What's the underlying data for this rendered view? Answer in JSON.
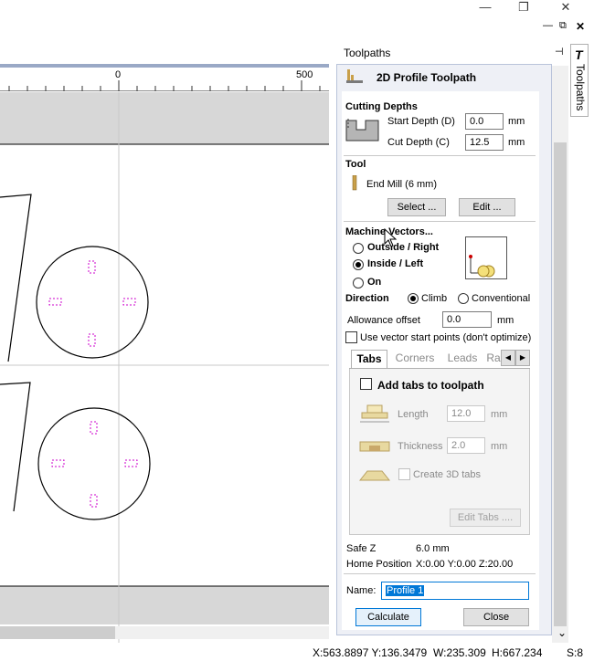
{
  "window": {
    "minimize_glyph": "—",
    "restore_glyph": "❐",
    "close_glyph": "✕",
    "inner_minimize_glyph": "—",
    "inner_restore_glyph": "⧉",
    "inner_close_glyph": "✕"
  },
  "ruler": {
    "labels": [
      "0",
      "500"
    ]
  },
  "panel": {
    "header": "Toolpaths",
    "title": "2D Profile Toolpath",
    "pin_glyph": "⊣",
    "close_glyph": "✕",
    "side_tab_label": "Toolpaths",
    "side_tab_icon": "T"
  },
  "cutting_depths": {
    "heading": "Cutting Depths",
    "start_label": "Start Depth (D)",
    "start_value": "0.0",
    "start_unit": "mm",
    "cut_label": "Cut Depth (C)",
    "cut_value": "12.5",
    "cut_unit": "mm"
  },
  "tool": {
    "heading": "Tool",
    "name": "End Mill (6 mm)",
    "select_label": "Select ...",
    "edit_label": "Edit ..."
  },
  "machine_vectors": {
    "heading": "Machine Vectors...",
    "options": [
      "Outside / Right",
      "Inside / Left",
      "On"
    ],
    "selected": "Inside / Left",
    "direction_label": "Direction",
    "directions": [
      "Climb",
      "Conventional"
    ],
    "direction_selected": "Climb",
    "allowance_label": "Allowance offset",
    "allowance_value": "0.0",
    "allowance_unit": "mm",
    "vector_start_label": "Use vector start points (don't optimize)"
  },
  "tabs": {
    "items": [
      "Tabs",
      "Corners",
      "Leads",
      "Ra"
    ],
    "active": "Tabs",
    "add_tabs_label": "Add tabs to toolpath",
    "length_label": "Length",
    "length_value": "12.0",
    "length_unit": "mm",
    "thickness_label": "Thickness",
    "thickness_value": "2.0",
    "thickness_unit": "mm",
    "create_3d_label": "Create 3D tabs",
    "edit_tabs_label": "Edit Tabs ....",
    "scroll_left": "◀",
    "scroll_right": "▶"
  },
  "info": {
    "safe_z_label": "Safe Z",
    "safe_z_value": "6.0 mm",
    "home_label": "Home Position",
    "home_value": "X:0.00 Y:0.00 Z:20.00"
  },
  "name": {
    "label": "Name:",
    "value": "Profile 1"
  },
  "actions": {
    "calculate": "Calculate",
    "close": "Close"
  },
  "status": {
    "coords": "X:563.8897 Y:136.3479",
    "width": "W:235.309",
    "height": "H:667.234",
    "selection": "S:8"
  },
  "scroll_down_glyph": "⌄"
}
